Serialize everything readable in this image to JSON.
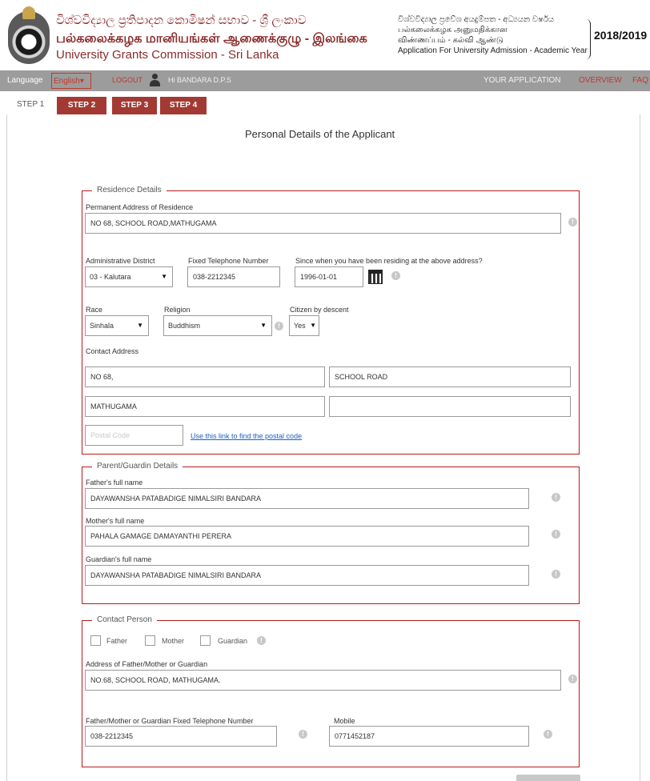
{
  "header": {
    "title_sinhala": "විශ්වවිද්‍යාල ප්‍රතිපාදන කොමිෂන් සභාව - ශ්‍රී ලංකාව",
    "title_tamil": "பல்கலைக்கழக மானியங்கள் ஆணைக்குழு - இலங்கை",
    "title_english": "University Grants Commission - Sri Lanka",
    "subtitle_sinhala": "විශ්වවිද්‍යාල ප්‍රවේශ අයදුම්පත - අධ්‍යයන වර්ෂය",
    "subtitle_tamil1": "பல்கலைக்கழக அனுமதிக்கான",
    "subtitle_tamil2": "விண்ணப்பம் - கல்வி ஆண்டு",
    "subtitle_english": "Application For University Admission - Academic Year",
    "year": "2018/2019"
  },
  "navbar": {
    "language_label": "Language",
    "language_value": "English",
    "logout": "LOGOUT",
    "user": "Hi BANDARA D.P.S",
    "your_application": "YOUR APPLICATION",
    "overview": "OVERVIEW",
    "faq": "FAQ"
  },
  "steps": {
    "current": "STEP 1",
    "tabs": [
      "STEP 2",
      "STEP 3",
      "STEP 4"
    ]
  },
  "page_title": "Personal Details of the Applicant",
  "residence": {
    "legend": "Residence Details",
    "permanent_label": "Permanent Address of Residence",
    "permanent_value": "NO 68, SCHOOL ROAD,MATHUGAMA",
    "district_label": "Administrative District",
    "district_value": "03 - Kalutara",
    "telephone_label": "Fixed Telephone Number",
    "telephone_value": "038-2212345",
    "since_label": "Since when you have been residing at the above address?",
    "since_value": "1996-01-01",
    "race_label": "Race",
    "race_value": "Sinhala",
    "religion_label": "Religion",
    "religion_value": "Buddhism",
    "citizen_label": "Citizen by descent",
    "citizen_value": "Yes",
    "contact_label": "Contact Address",
    "contact_line1": "NO 68,",
    "contact_line2": "SCHOOL ROAD",
    "contact_line3": "MATHUGAMA",
    "contact_line4": "",
    "postal_placeholder": "Postal Code",
    "postal_link": "Use this link to find the postal code"
  },
  "parent": {
    "legend": "Parent/Guardin Details",
    "father_label": "Father's full name",
    "father_value": "DAYAWANSHA PATABADIGE NIMALSIRI BANDARA",
    "mother_label": "Mother's full name",
    "mother_value": "PAHALA GAMAGE DAMAYANTHI PERERA",
    "guardian_label": "Guardian's full name",
    "guardian_value": "DAYAWANSHA PATABADIGE NIMALSIRI BANDARA"
  },
  "contact_person": {
    "legend": "Contact Person",
    "options": [
      "Father",
      "Mother",
      "Guardian"
    ],
    "address_label": "Address of Father/Mother or Guardian",
    "address_value": "NO.68, SCHOOL ROAD, MATHUGAMA.",
    "phone_label": "Father/Mother or Guardian Fixed Telephone Number",
    "phone_value": "038-2212345",
    "mobile_label": "Mobile",
    "mobile_value": "0771452187"
  },
  "colors": {
    "brand": "#8a2a2a",
    "accent": "#a23a33",
    "section_border": "#b71c1c",
    "navbar": "#9c9c9c",
    "link": "#1a5fc7"
  }
}
